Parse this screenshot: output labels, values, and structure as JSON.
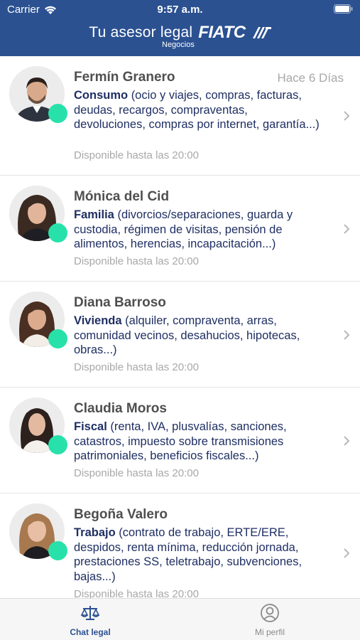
{
  "status_bar": {
    "carrier": "Carrier",
    "time": "9:57 a.m."
  },
  "header": {
    "title": "Tu asesor legal",
    "brand": "FIATC",
    "subtitle": "Negocios"
  },
  "colors": {
    "header": "#2b5191",
    "online": "#28e1aa",
    "text_dark": "#1f2f63",
    "muted": "#a8a8a8"
  },
  "lawyers": [
    {
      "name": "Fermín Granero",
      "date": "Hace 6 Días",
      "category": "Consumo",
      "description": "(ocio y viajes, compras, facturas, deudas, recargos, compraventas, devoluciones, compras por internet, garantía...)",
      "availability": "Disponible hasta las 20:00"
    },
    {
      "name": "Mónica del Cid",
      "date": "",
      "category": "Familia",
      "description": "(divorcios/separaciones, guarda y custodia, régimen de visitas, pensión de alimentos, herencias, incapacitación...)",
      "availability": "Disponible hasta las 20:00"
    },
    {
      "name": "Diana Barroso",
      "date": "",
      "category": "Vivienda",
      "description": "(alquiler, compraventa, arras, comunidad vecinos, desahucios, hipotecas, obras...)",
      "availability": "Disponible hasta las 20:00"
    },
    {
      "name": "Claudia Moros",
      "date": "",
      "category": "Fiscal",
      "description": "(renta, IVA, plusvalías, sanciones, catastros, impuesto sobre transmisiones patrimoniales, beneficios fiscales...)",
      "availability": "Disponible hasta las 20:00"
    },
    {
      "name": "Begoña Valero",
      "date": "",
      "category": "Trabajo",
      "description": "(contrato de trabajo, ERTE/ERE, despidos, renta mínima, reducción jornada, prestaciones SS, teletrabajo, subvenciones, bajas...)",
      "availability": "Disponible hasta las 20:00"
    }
  ],
  "tabs": [
    {
      "label": "Chat legal",
      "icon": "scale-icon",
      "active": true
    },
    {
      "label": "Mi perfil",
      "icon": "profile-icon",
      "active": false
    }
  ]
}
